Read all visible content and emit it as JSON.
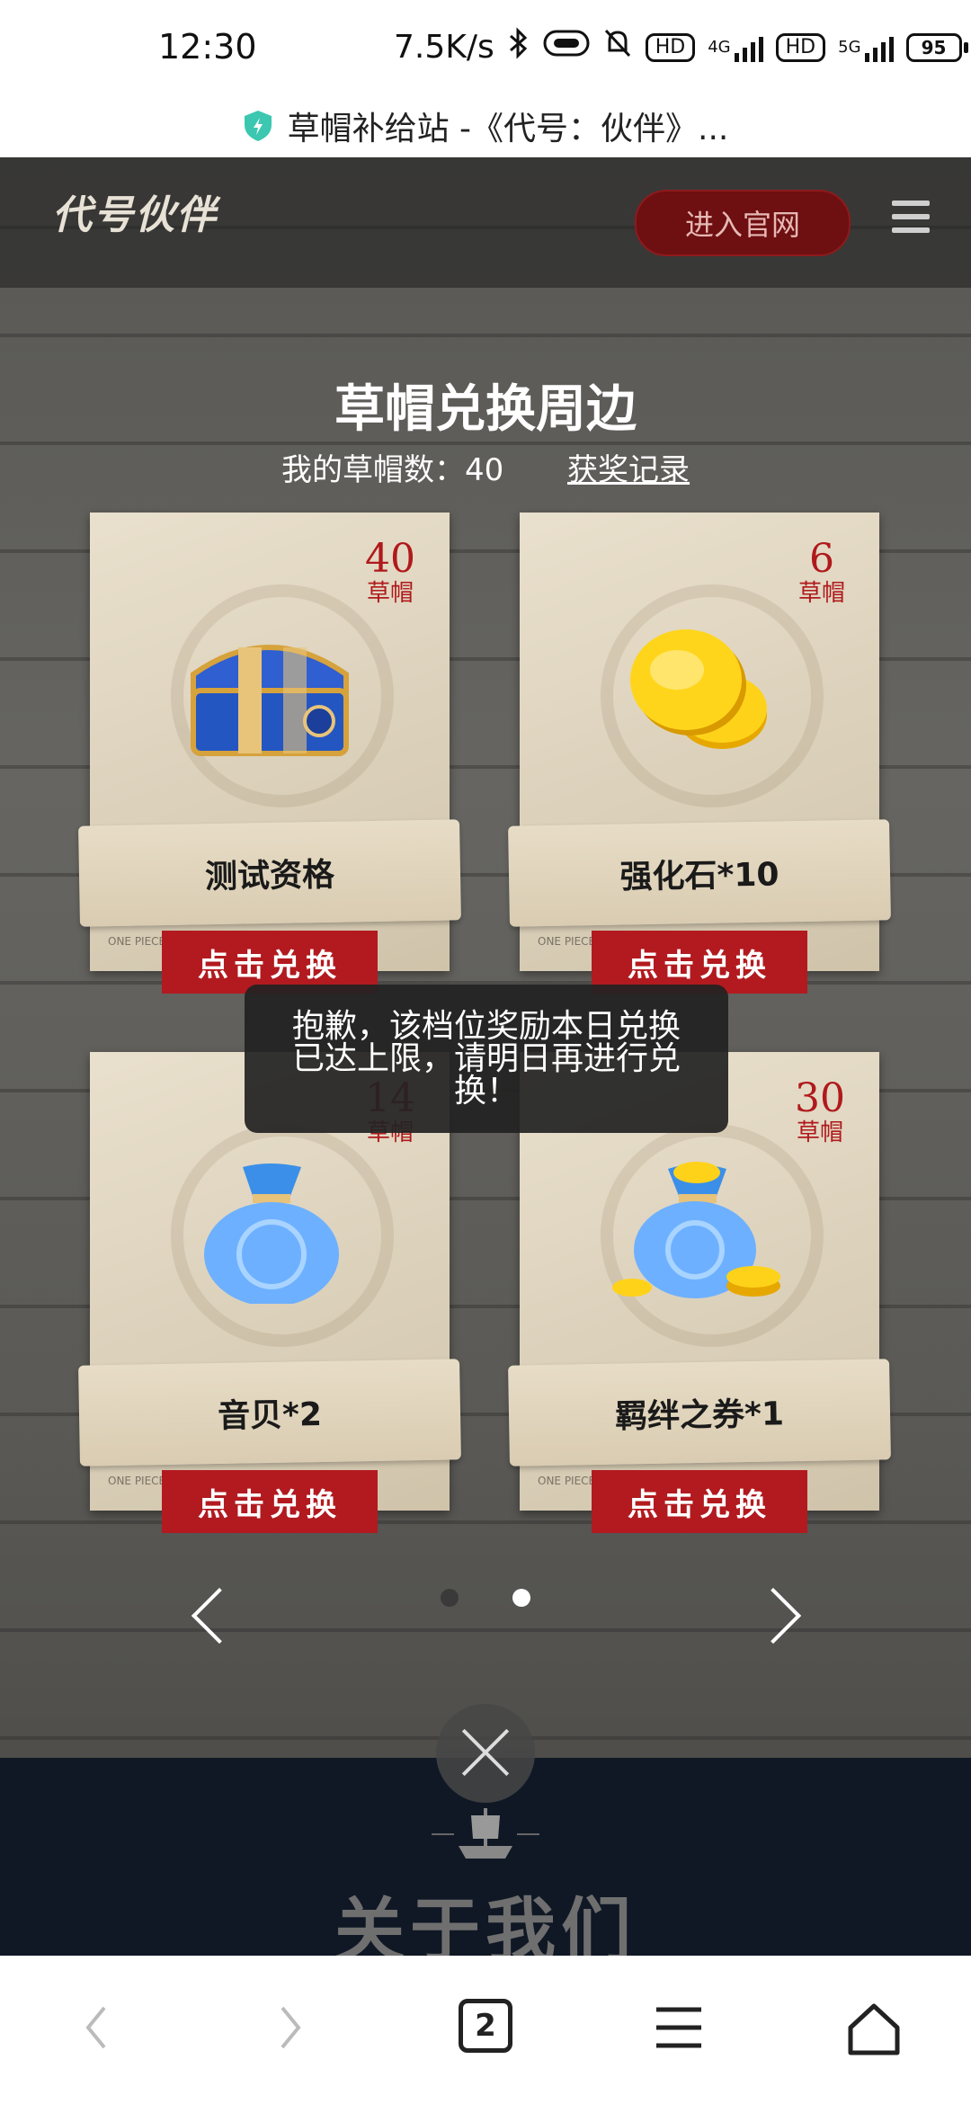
{
  "status_bar": {
    "time": "12:30",
    "speed": "7.5K/s",
    "network1": "4G",
    "network2": "5G",
    "hd1": "HD",
    "hd2": "HD",
    "battery": "95"
  },
  "url_bar": {
    "title": "草帽补给站 -《代号：伙伴》..."
  },
  "nav": {
    "logo": "代号伙伴",
    "enter_button": "进入官网"
  },
  "main": {
    "title": "草帽兑换周边",
    "hat_count_label": "我的草帽数：40",
    "records_link": "获奖记录"
  },
  "cards": [
    {
      "price": "40",
      "unit": "草帽",
      "name": "测试资格",
      "button": "点击兑换",
      "image": "treasure-chest"
    },
    {
      "price": "6",
      "unit": "草帽",
      "name": "强化石*10",
      "button": "点击兑换",
      "image": "gold-coins"
    },
    {
      "price": "14",
      "unit": "草帽",
      "name": "音贝*2",
      "button": "点击兑换",
      "image": "blue-pouch"
    },
    {
      "price": "30",
      "unit": "草帽",
      "name": "羁绊之券*1",
      "button": "点击兑换",
      "image": "coin-pouch"
    }
  ],
  "toast": {
    "message": "抱歉，该档位奖励本日兑换已达上限，请明日再进行兑换！"
  },
  "pagination": {
    "total": 2,
    "active": 2
  },
  "about": {
    "title": "关于我们"
  },
  "browser_nav": {
    "tabs_count": "2"
  },
  "colors": {
    "accent_red": "#b21a1f",
    "dark_footer": "#101825"
  }
}
